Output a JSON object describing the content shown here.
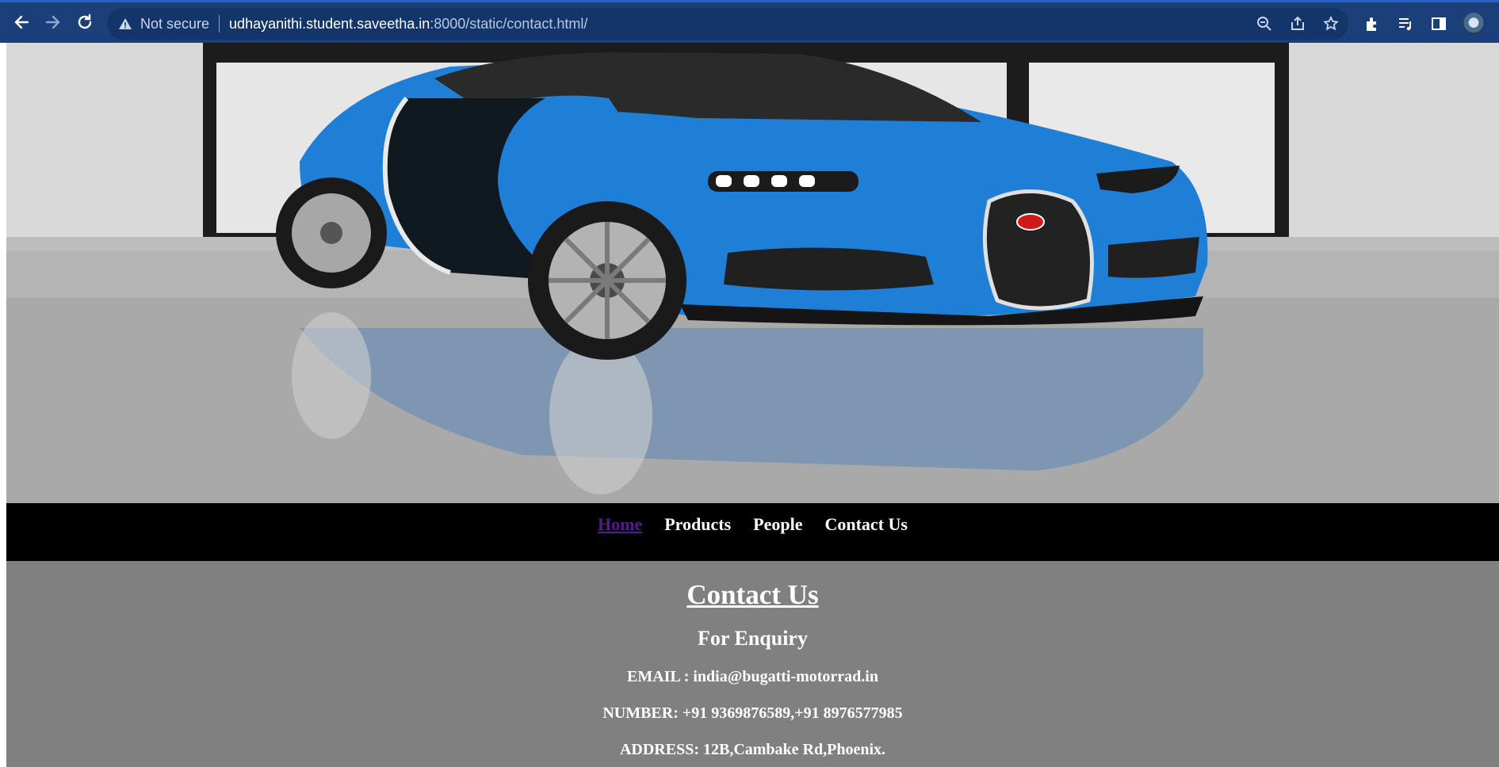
{
  "browser": {
    "security_label": "Not secure",
    "url_host": "udhayanithi.student.saveetha.in",
    "url_path": ":8000/static/contact.html/",
    "colors": {
      "chrome": "#1b3f78",
      "omnibox": "#143569"
    }
  },
  "hero": {
    "image_subject": "blue-sports-car"
  },
  "nav": {
    "items": [
      {
        "label": "Home"
      },
      {
        "label": "Products"
      },
      {
        "label": "People"
      },
      {
        "label": "Contact Us"
      }
    ]
  },
  "contact": {
    "title": "Contact Us",
    "subtitle": "For Enquiry",
    "email": "EMAIL : india@bugatti-motorrad.in",
    "number": "NUMBER: +91 9369876589,+91 8976577985",
    "address": "ADDRESS: 12B,Cambake Rd,Phoenix."
  },
  "colors": {
    "nav_bg": "#000000",
    "content_bg": "#808080",
    "visited_link": "#551a8b",
    "car_blue": "#1f7fd6"
  }
}
